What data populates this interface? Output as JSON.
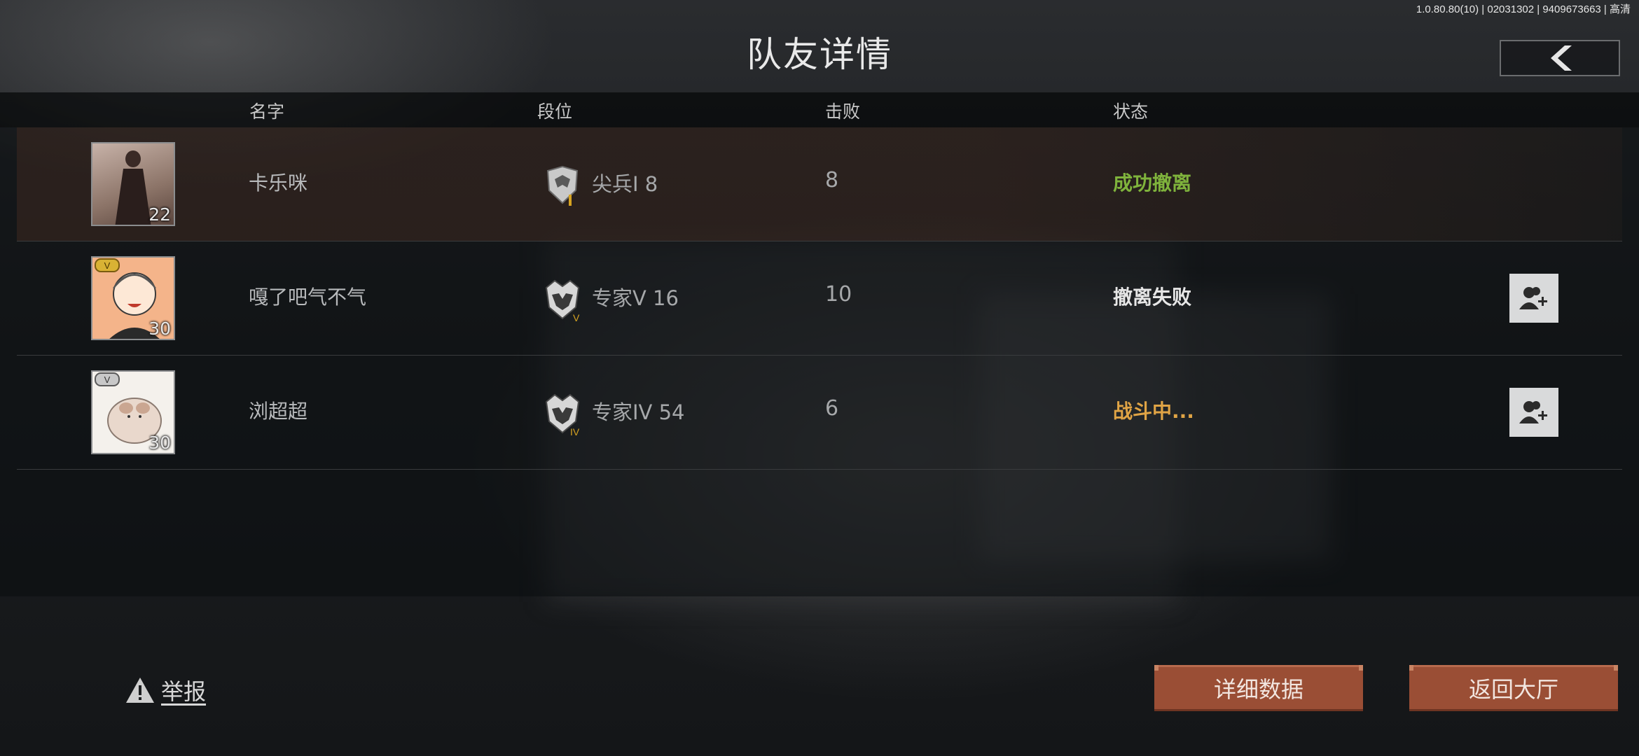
{
  "version": "1.0.80.80(10) | 02031302 | 9409673663 | 高清",
  "page_title": "队友详情",
  "columns": {
    "name": "名字",
    "rank": "段位",
    "kills": "击败",
    "status": "状态"
  },
  "players": [
    {
      "name": "卡乐咪",
      "level": "22",
      "rank": "尖兵I  8",
      "kills": "8",
      "status": "成功撤离",
      "status_color": "#7fb33c",
      "is_self": true,
      "rank_icon": "eagle-rank-icon",
      "vip": false
    },
    {
      "name": "嘎了吧气不气",
      "level": "30",
      "rank": "专家V  16",
      "kills": "10",
      "status": "撤离失败",
      "status_color": "#e6e6e6",
      "is_self": false,
      "rank_icon": "wolf-rank-icon",
      "vip": true,
      "vip_color": "#d9b234"
    },
    {
      "name": "浏超超",
      "level": "30",
      "rank": "专家IV  54",
      "kills": "6",
      "status": "战斗中...",
      "status_color": "#e0a445",
      "is_self": false,
      "rank_icon": "wolf-rank-icon",
      "vip": true,
      "vip_color": "#c8c8c8"
    }
  ],
  "report_label": "举报",
  "buttons": {
    "details": "详细数据",
    "lobby": "返回大厅"
  },
  "colors": {
    "accent_button": "#9a4e35",
    "success": "#7fb33c",
    "in_battle": "#e0a445"
  }
}
